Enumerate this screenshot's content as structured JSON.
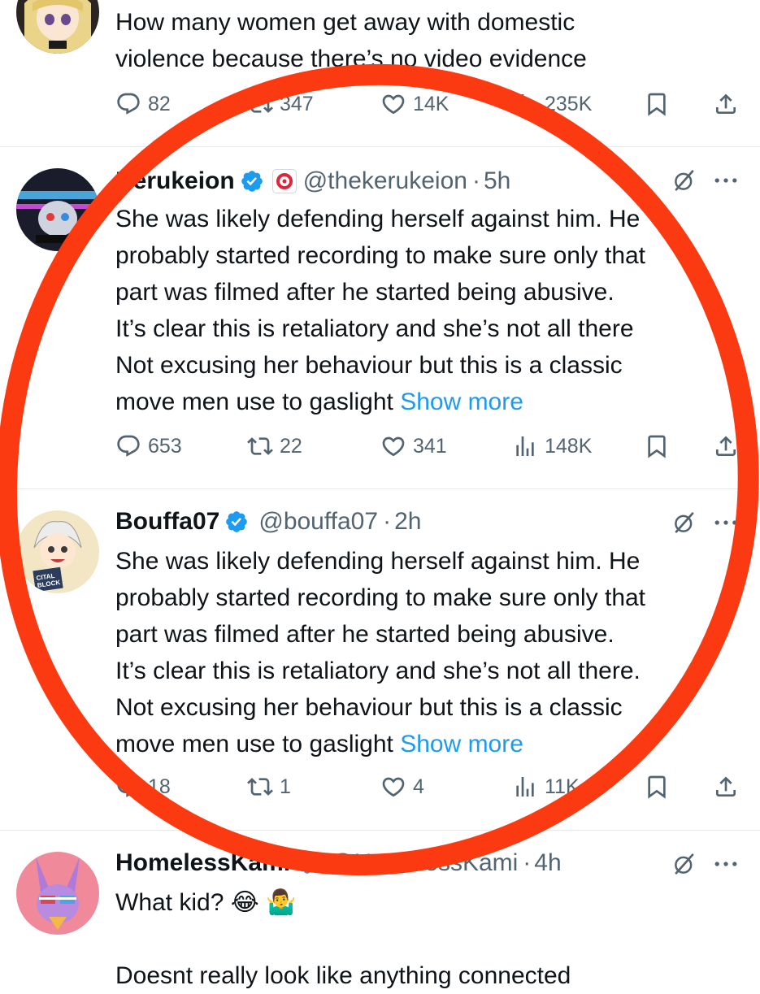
{
  "colors": {
    "accent": "#1d9bf0",
    "verified": "#1d9bf0",
    "secondary_text": "#536471",
    "annotation": "#fb3a12"
  },
  "tweets": [
    {
      "avatar_icon": "anime-girl-avatar",
      "text": "How many women get away with domestic\nviolence because there’s no video evidence",
      "actions": {
        "replies": "82",
        "reposts": "347",
        "likes": "14K",
        "views": "235K"
      }
    },
    {
      "name": "Kerukeion",
      "handle": "@thekerukeion",
      "time": "5h",
      "avatar_icon": "glitch-art-avatar",
      "text": "She was likely defending herself against him. He\nprobably started recording to make sure only that\npart was filmed after he started being abusive.\nIt’s clear this is retaliatory and she’s not all there\nNot excusing her behaviour but this is a classic\nmove men use to gaslight ",
      "show_more": "Show more",
      "actions": {
        "replies": "653",
        "reposts": "22",
        "likes": "341",
        "views": "148K"
      }
    },
    {
      "name": "Bouffa07",
      "handle": "@bouffa07",
      "time": "2h",
      "avatar_icon": "anime-boy-book-avatar",
      "avatar_text": "CITAL\nBLOCK",
      "text": "She was likely defending herself against him. He\nprobably started recording to make sure only that\npart was filmed after he started being abusive.\nIt’s clear this is retaliatory and she’s not all there.\nNot excusing her behaviour but this is a classic\nmove men use to gaslight ",
      "show_more": "Show more",
      "actions": {
        "replies": "18",
        "reposts": "1",
        "likes": "4",
        "views": "11K"
      }
    },
    {
      "name": "HomelessKami",
      "handle": "@HomelessKami",
      "time": "4h",
      "avatar_icon": "cartoon-rabbit-avatar",
      "text": "What kid? 😂 🤷‍♂️",
      "text_2": "Doesnt really look like anything connected"
    }
  ]
}
